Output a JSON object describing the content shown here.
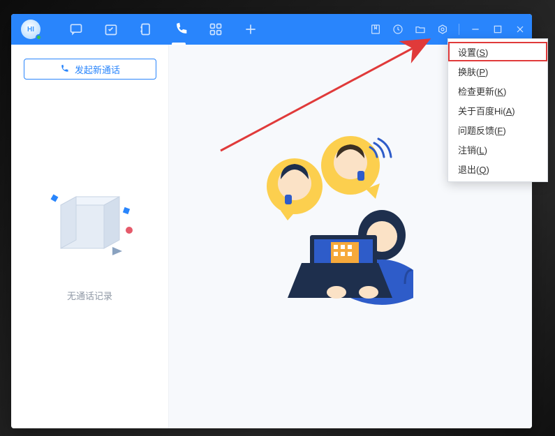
{
  "avatar_text": "HI",
  "sidebar": {
    "new_call_label": "发起新通话",
    "empty_label": "无通话记录"
  },
  "menu": {
    "items": [
      {
        "label": "设置",
        "accel": "S"
      },
      {
        "label": "换肤",
        "accel": "P"
      },
      {
        "label": "检查更新",
        "accel": "K"
      },
      {
        "label": "关于百度Hi",
        "accel": "A"
      },
      {
        "label": "问题反馈",
        "accel": "F"
      },
      {
        "label": "注销",
        "accel": "L"
      },
      {
        "label": "退出",
        "accel": "Q"
      }
    ]
  },
  "colors": {
    "primary": "#2985fc",
    "annotation": "#e03a3a"
  }
}
